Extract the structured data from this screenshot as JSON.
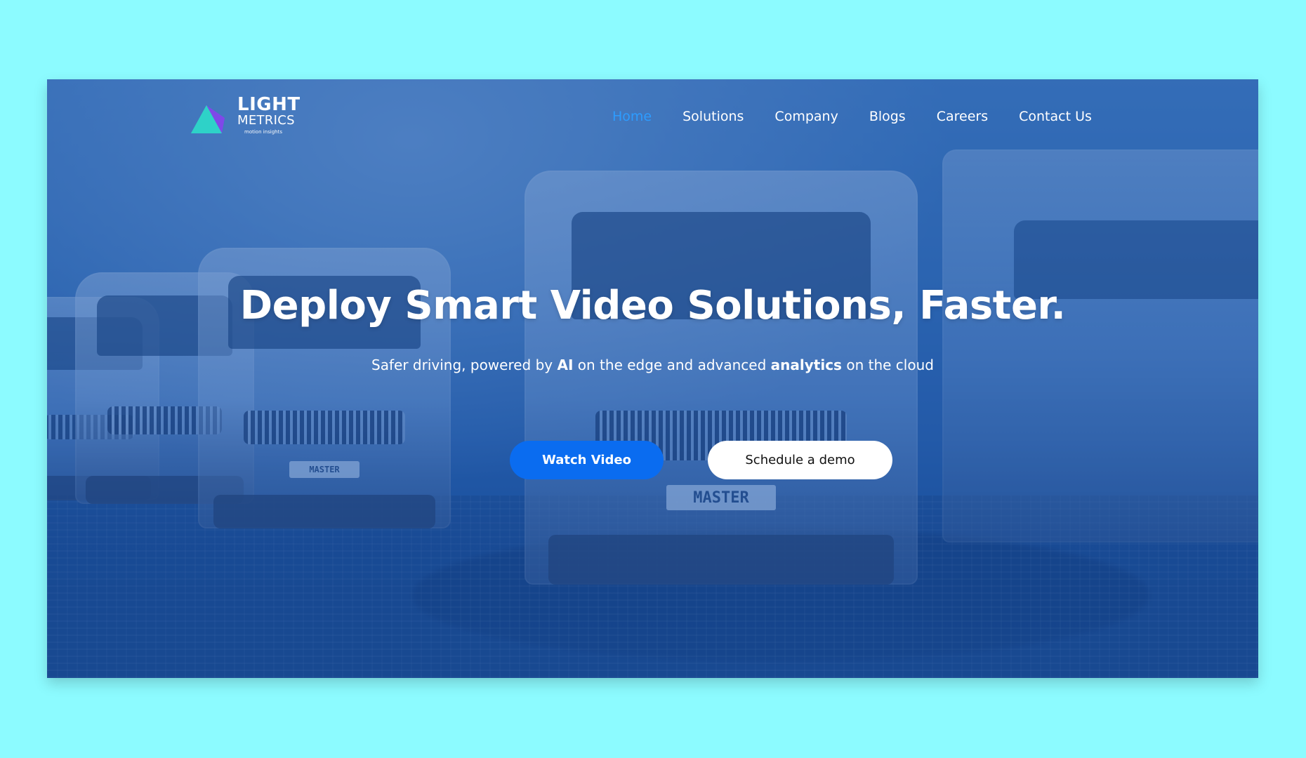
{
  "brand": {
    "name_line1": "LIGHT",
    "name_line2": "METRICS",
    "tagline": "motion insights",
    "logo_colors": [
      "#2fd1c8",
      "#8a3ff0"
    ]
  },
  "nav": {
    "items": [
      {
        "label": "Home",
        "active": true
      },
      {
        "label": "Solutions",
        "active": false
      },
      {
        "label": "Company",
        "active": false
      },
      {
        "label": "Blogs",
        "active": false
      },
      {
        "label": "Careers",
        "active": false
      },
      {
        "label": "Contact Us",
        "active": false
      }
    ],
    "active_color": "#2d9cff"
  },
  "hero": {
    "title": "Deploy Smart Video Solutions, Faster.",
    "subtitle_parts": {
      "p1": "Safer driving, powered by ",
      "b1": "AI",
      "p2": " on the edge and advanced ",
      "b2": "analytics",
      "p3": " on the cloud"
    },
    "buttons": {
      "watch_video": "Watch Video",
      "schedule_demo": "Schedule a demo"
    },
    "plates": {
      "primary": "MASTER",
      "secondary": "MASTER"
    }
  },
  "colors": {
    "page_background": "#8cfbff",
    "overlay_blue": "#1652aa",
    "primary_button": "#0a6cf0"
  }
}
